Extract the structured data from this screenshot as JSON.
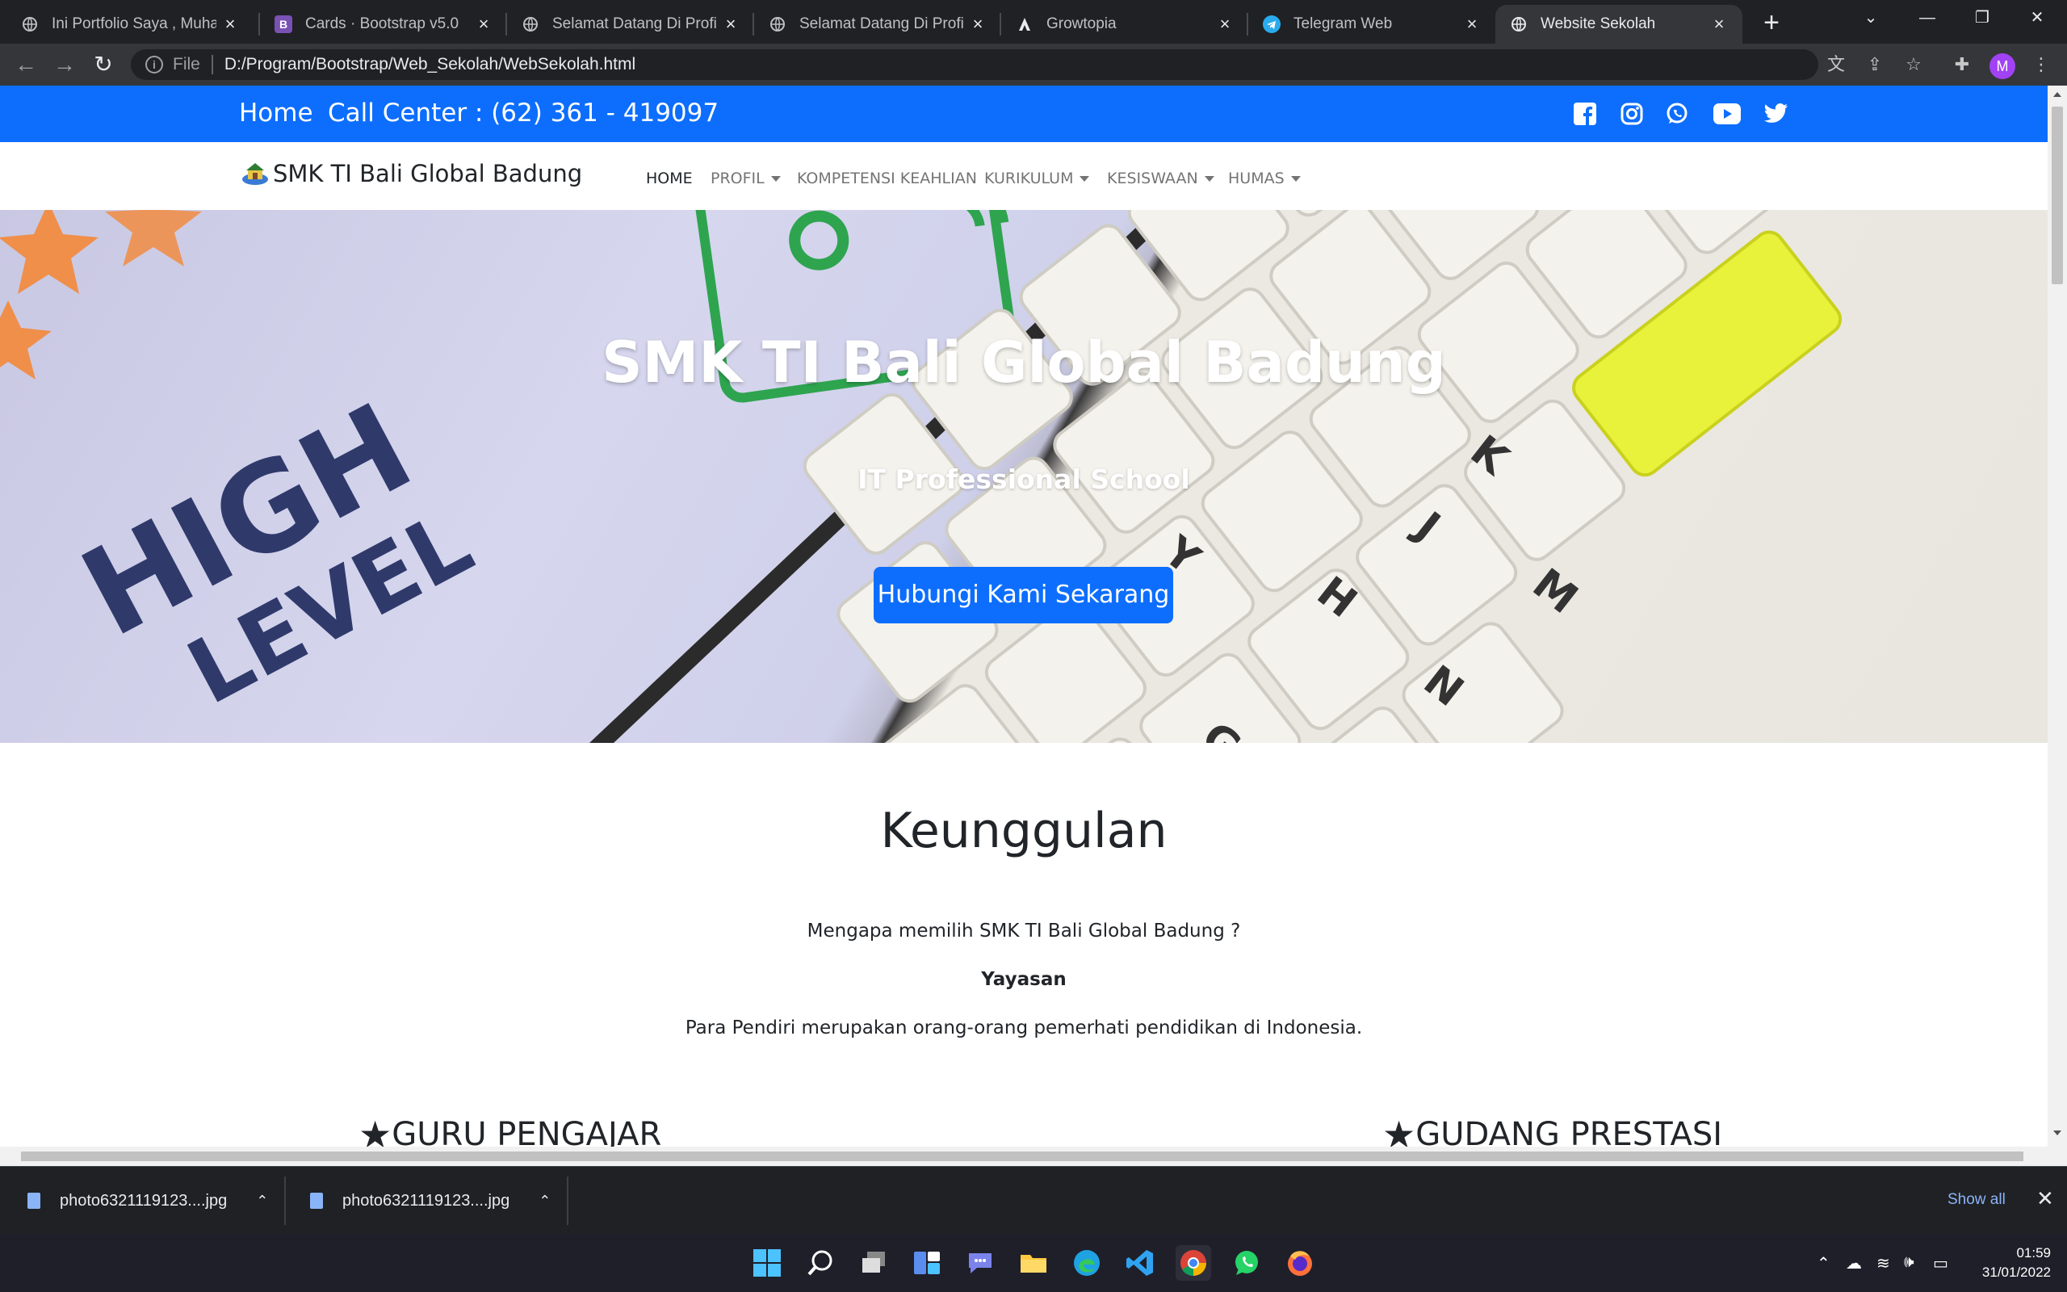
{
  "browser": {
    "tabs": [
      {
        "title": "Ini Portfolio Saya , Muham",
        "icon": "globe-icon"
      },
      {
        "title": "Cards · Bootstrap v5.0",
        "icon": "bootstrap-icon"
      },
      {
        "title": "Selamat Datang Di Profil S",
        "icon": "globe-icon"
      },
      {
        "title": "Selamat Datang Di Profil S",
        "icon": "globe-icon"
      },
      {
        "title": "Growtopia",
        "icon": "growtopia-icon"
      },
      {
        "title": "Telegram Web",
        "icon": "telegram-icon"
      },
      {
        "title": "Website Sekolah",
        "icon": "globe-icon",
        "active": true
      }
    ],
    "address": {
      "scheme": "File",
      "url": "D:/Program/Bootstrap/Web_Sekolah/WebSekolah.html"
    },
    "profile_initial": "M"
  },
  "page": {
    "topbar": {
      "home": "Home",
      "call_center": "Call Center : (62) 361 - 419097"
    },
    "social_icons": [
      "facebook-icon",
      "instagram-icon",
      "whatsapp-icon",
      "youtube-icon",
      "twitter-icon"
    ],
    "brand": "SMK TI Bali Global Badung",
    "nav": [
      {
        "label": "HOME",
        "active": true,
        "dropdown": false
      },
      {
        "label": "PROFIL",
        "dropdown": true
      },
      {
        "label": "KOMPETENSI KEAHLIAN",
        "dropdown": false
      },
      {
        "label": "KURIKULUM",
        "dropdown": true
      },
      {
        "label": "KESISWAAN",
        "dropdown": true
      },
      {
        "label": "HUMAS",
        "dropdown": true
      }
    ],
    "hero": {
      "title": "SMK TI Bali Global Badung",
      "subtitle": "IT Professional School",
      "button": "Hubungi Kami Sekarang"
    },
    "keunggulan": {
      "title": "Keunggulan",
      "question": "Mengapa memilih SMK TI Bali Global Badung ?",
      "heading": "Yayasan",
      "text": "Para Pendiri merupakan orang-orang pemerhati pendidikan di Indonesia."
    },
    "features": [
      "GURU PENGAJAR",
      "GUDANG PRESTASI"
    ]
  },
  "downloads": {
    "items": [
      "photo6321119123....jpg",
      "photo6321119123....jpg"
    ],
    "show_all": "Show all"
  },
  "taskbar": {
    "time": "01:59",
    "date": "31/01/2022"
  },
  "colors": {
    "primary": "#0d6efd",
    "chrome_dark": "#202124",
    "chrome_toolbar": "#35363a"
  }
}
